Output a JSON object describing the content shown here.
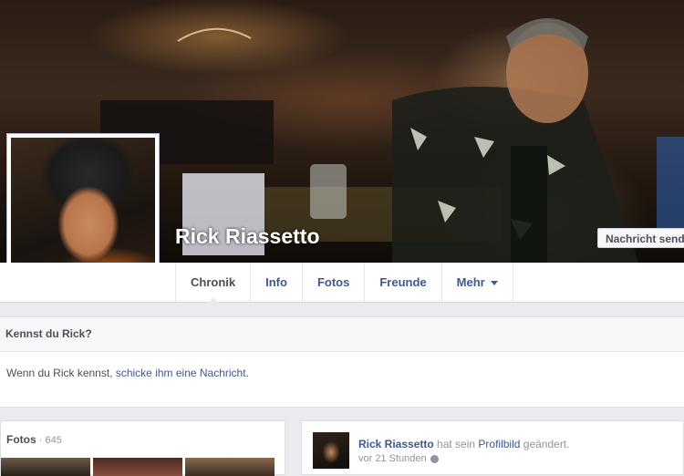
{
  "profile": {
    "name": "Rick Riassetto",
    "message_button": "Nachricht senden"
  },
  "nav": {
    "tabs": [
      {
        "label": "Chronik",
        "active": true
      },
      {
        "label": "Info"
      },
      {
        "label": "Fotos"
      },
      {
        "label": "Freunde"
      },
      {
        "label": "Mehr"
      }
    ]
  },
  "know_box": {
    "title": "Kennst du Rick?",
    "text_before": "Wenn du Rick kennst, ",
    "link": "schicke ihm eine Nachricht",
    "text_after": "."
  },
  "photos": {
    "title": "Fotos",
    "separator": " · ",
    "count": "645"
  },
  "post": {
    "author": "Rick Riassetto",
    "action_prefix": " hat sein ",
    "action_link": "Profilbild",
    "action_suffix": " geändert.",
    "time": "vor 21 Stunden",
    "audience_icon": "globe-icon"
  },
  "colors": {
    "link": "#3b5998",
    "page_bg": "#e9ebee"
  }
}
